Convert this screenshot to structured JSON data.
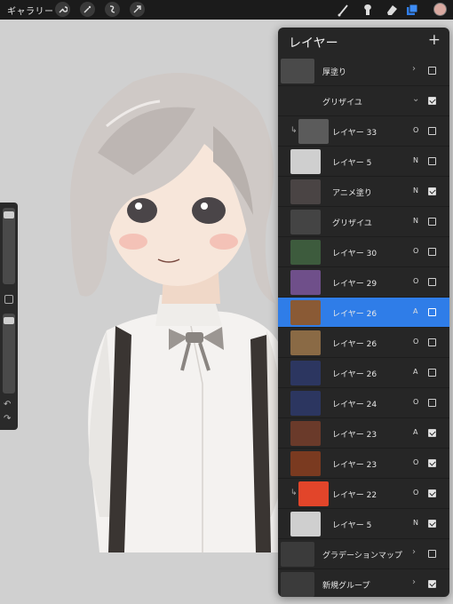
{
  "toolbar": {
    "gallery_label": "ギャラリー",
    "left_icons": [
      "wrench-icon",
      "magic-wand-icon",
      "selection-icon",
      "transform-arrow-icon"
    ],
    "right_tools": [
      "brush-icon",
      "smudge-icon",
      "eraser-icon",
      "layers-icon"
    ],
    "color_swatch": "#d9a9a0"
  },
  "layers_panel": {
    "title": "レイヤー",
    "add_label": "+",
    "layers": [
      {
        "name": "厚塗り",
        "kind": "group",
        "blend": "",
        "visible": false,
        "collapsed": true
      },
      {
        "name": "グリザイユ",
        "kind": "group",
        "blend": "",
        "visible": true,
        "collapsed": false
      },
      {
        "name": "レイヤー 33",
        "kind": "clip",
        "blend": "O",
        "visible": false
      },
      {
        "name": "レイヤー 5",
        "kind": "layer",
        "blend": "N",
        "visible": false
      },
      {
        "name": "アニメ塗り",
        "kind": "layer",
        "blend": "N",
        "visible": true
      },
      {
        "name": "グリザイユ",
        "kind": "layer",
        "blend": "N",
        "visible": false
      },
      {
        "name": "レイヤー 30",
        "kind": "layer",
        "blend": "O",
        "visible": false
      },
      {
        "name": "レイヤー 29",
        "kind": "layer",
        "blend": "O",
        "visible": false
      },
      {
        "name": "レイヤー 26",
        "kind": "layer",
        "blend": "A",
        "visible": false,
        "selected": true
      },
      {
        "name": "レイヤー 26",
        "kind": "layer",
        "blend": "O",
        "visible": false
      },
      {
        "name": "レイヤー 26",
        "kind": "layer",
        "blend": "A",
        "visible": false
      },
      {
        "name": "レイヤー 24",
        "kind": "layer",
        "blend": "O",
        "visible": false
      },
      {
        "name": "レイヤー 23",
        "kind": "layer",
        "blend": "A",
        "visible": true
      },
      {
        "name": "レイヤー 23",
        "kind": "layer",
        "blend": "O",
        "visible": true
      },
      {
        "name": "レイヤー 22",
        "kind": "clip",
        "blend": "O",
        "visible": true
      },
      {
        "name": "レイヤー 5",
        "kind": "layer",
        "blend": "N",
        "visible": true
      },
      {
        "name": "グラデーションマップ",
        "kind": "group",
        "blend": "",
        "visible": false,
        "collapsed": true
      },
      {
        "name": "新規グループ",
        "kind": "group",
        "blend": "",
        "visible": true,
        "collapsed": true
      }
    ]
  },
  "colors": {
    "accent_selected": "#2f7de8",
    "panel_bg": "#262626"
  }
}
